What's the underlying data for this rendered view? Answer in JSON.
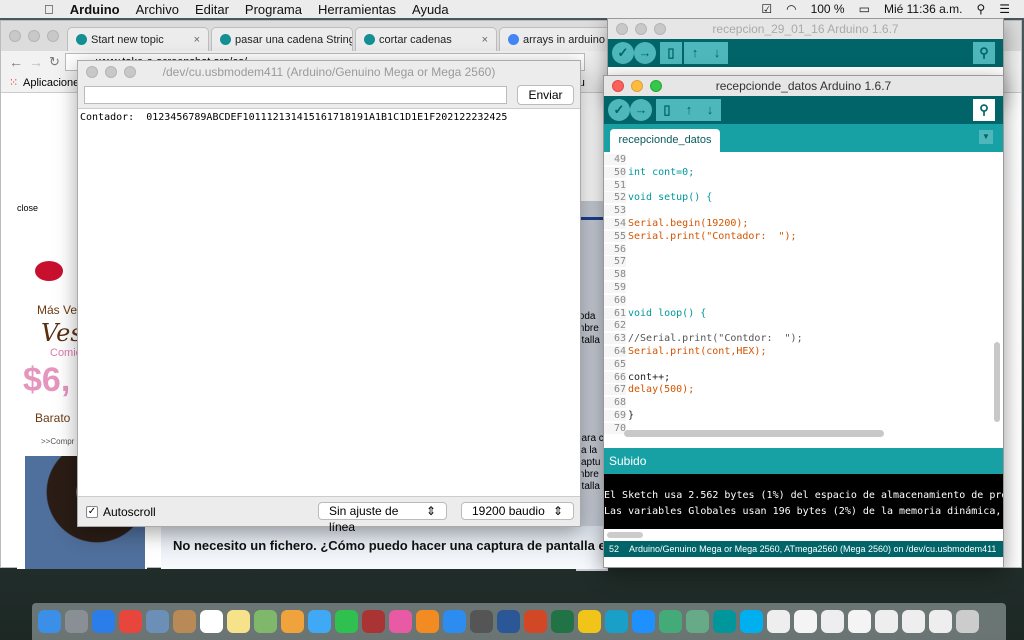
{
  "menubar": {
    "app": "Arduino",
    "items": [
      "Archivo",
      "Editar",
      "Programa",
      "Herramientas",
      "Ayuda"
    ],
    "battery": "100 %",
    "clock": "Mié 11:36 a.m."
  },
  "browser": {
    "tabs": [
      "Start new topic",
      "pasar una cadena String",
      "cortar cadenas",
      "arrays in arduino - Go"
    ],
    "url": "www.take-a-screenshot.org/es/",
    "bookmarks_label": "Aplicaciones",
    "partial_right": "nfigu",
    "ad": {
      "close": "close",
      "line1": "Más Ve",
      "line2": "Vest",
      "line3": "Comie",
      "price": "$6,",
      "line4": "Barato",
      "line5": ">>Compr"
    },
    "partial_text": [
      "toda",
      "mbre",
      "ntalla",
      "para c",
      "sa la",
      "captu",
      "mbre",
      "ntalla"
    ],
    "question": "No necesito un fichero. ¿Cómo puedo hacer una captura de pantalla en"
  },
  "serial": {
    "title": "/dev/cu.usbmodem411 (Arduino/Genuino Mega or Mega 2560)",
    "input_value": "",
    "send": "Enviar",
    "output": "Contador:  0123456789ABCDEF101112131415161718191A1B1C1D1E1F202122232425",
    "autoscroll": "Autoscroll",
    "autoscroll_checked": true,
    "line_ending": "Sin ajuste de línea",
    "baud": "19200 baudio"
  },
  "arduino_back": {
    "title": "recepcion_29_01_16 Arduino 1.6.7"
  },
  "arduino_front": {
    "title": "recepcionde_datos Arduino 1.6.7",
    "tab": "recepcionde_datos",
    "line_numbers": [
      "49",
      "50",
      "51",
      "52",
      "53",
      "54",
      "55",
      "56",
      "57",
      "58",
      "59",
      "60",
      "61",
      "62",
      "63",
      "64",
      "65",
      "66",
      "67",
      "68",
      "69",
      "70"
    ],
    "code": [
      "",
      "int cont=0;",
      "",
      "void setup() {",
      "",
      "Serial.begin(19200);",
      "Serial.print(\"Contador:  \");",
      "",
      "",
      "",
      "",
      "",
      "void loop() {",
      "",
      "//Serial.print(\"Contdor:  \");",
      "Serial.print(cont,HEX);",
      "",
      "cont++;",
      "delay(500);",
      "",
      "}",
      ""
    ],
    "status_label": "Subido",
    "console": [
      "El Sketch usa 2.562 bytes (1%) del espacio de almacenamiento de progra",
      "Las variables Globales usan 196 bytes (2%) de la memoria dinámica, de"
    ],
    "status_line": "52",
    "board": "Arduino/Genuino Mega or Mega 2560, ATmega2560 (Mega 2560) on /dev/cu.usbmodem411"
  },
  "dock": {
    "apps": [
      "finder",
      "launchpad",
      "safari",
      "chrome",
      "preview",
      "contacts",
      "calendar",
      "notes",
      "maps",
      "photos",
      "messages",
      "facetime",
      "photo-booth",
      "itunes",
      "ibooks",
      "app-store",
      "system-preferences",
      "word",
      "powerpoint",
      "excel",
      "outlook",
      "c-app",
      "lync",
      "downloader",
      "screen-sharing",
      "arduino",
      "skype",
      "document",
      "file",
      "file",
      "file",
      "file",
      "file",
      "arduino-file",
      "trash"
    ],
    "calendar_day": "3",
    "appstore_badge": "1"
  }
}
